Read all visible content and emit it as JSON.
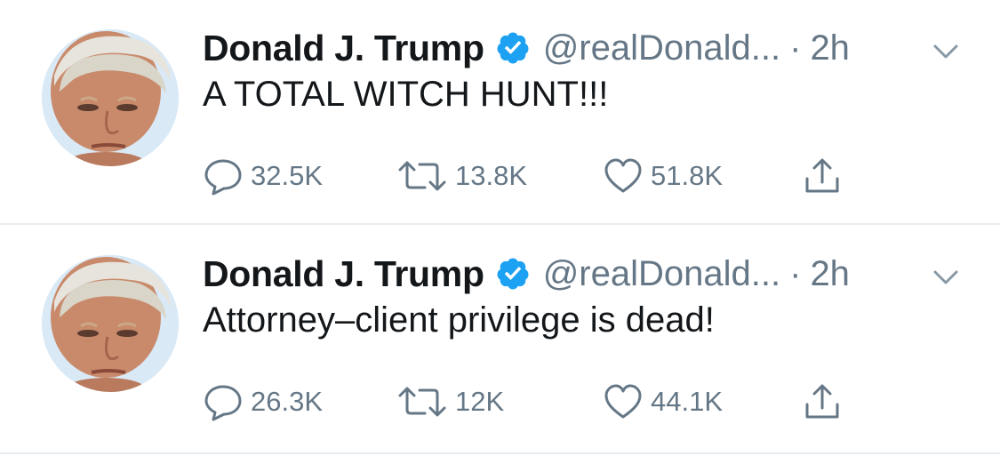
{
  "tweets": [
    {
      "author_name": "Donald J. Trump",
      "handle": "@realDonald...",
      "separator": "·",
      "time": "2h",
      "text": "A TOTAL WITCH HUNT!!!",
      "replies": "32.5K",
      "retweets": "13.8K",
      "likes": "51.8K"
    },
    {
      "author_name": "Donald J. Trump",
      "handle": "@realDonald...",
      "separator": "·",
      "time": "2h",
      "text": "Attorney–client privilege is dead!",
      "replies": "26.3K",
      "retweets": "12K",
      "likes": "44.1K"
    }
  ],
  "colors": {
    "text_primary": "#14171a",
    "text_secondary": "#657786",
    "verified_blue": "#1da1f2",
    "divider": "#e6ecf0"
  },
  "icons": {
    "verified": "verified-badge-icon",
    "caret": "chevron-down-icon",
    "reply": "reply-bubble-icon",
    "retweet": "retweet-icon",
    "like": "heart-icon",
    "share": "share-icon"
  }
}
